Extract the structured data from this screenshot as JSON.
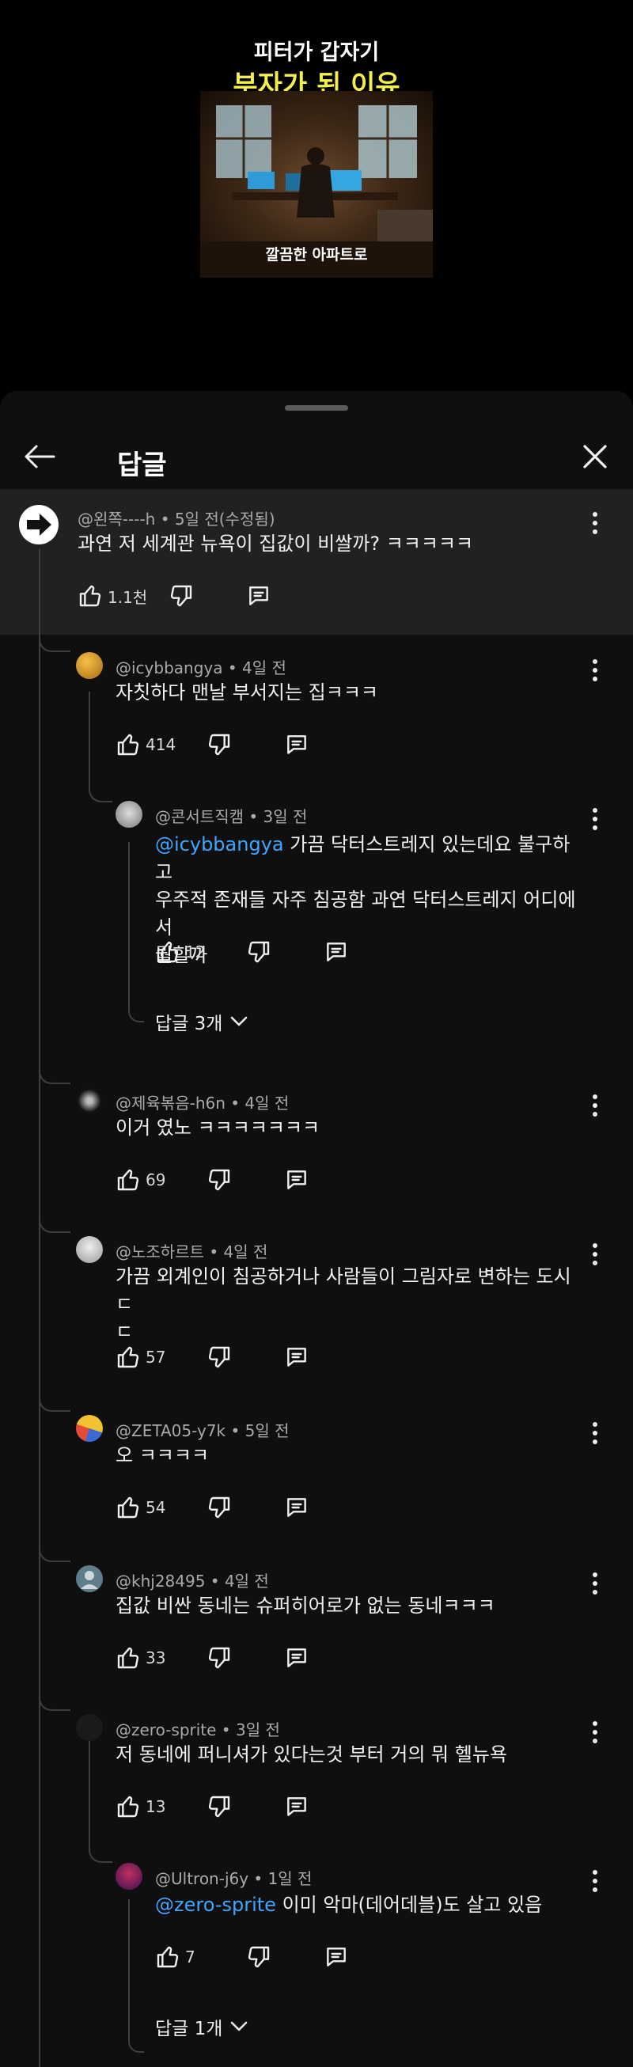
{
  "video": {
    "title_line1": "피터가 갑자기",
    "title_line2": "부자가 된 이유",
    "caption": "깔끔한 아파트로"
  },
  "header": {
    "title": "답글"
  },
  "top_comment": {
    "meta": "@왼쪽----h • 5일 전(수정됨)",
    "text": "과연 저 세계관 뉴욕이 집값이 비쌀까? ㅋㅋㅋㅋㅋ",
    "likes": "1.1천"
  },
  "replies": [
    {
      "meta": "@icybbangya • 4일 전",
      "text": "자칫하다 맨날 부서지는 집ㅋㅋㅋ",
      "likes": "414"
    },
    {
      "meta": "@콘서트직캠 • 3일 전",
      "mention": "@icybbangya",
      "text_line1": " 가끔 닥터스트레지 있는데요 불구하고",
      "text_line2": "우주적 존재들 자주 침공함 과연 닥터스트레지 어디에서",
      "text_line3": "뭘할까",
      "likes": "12",
      "sub_replies": "답글 3개"
    },
    {
      "meta": "@제육볶음-h6n • 4일 전",
      "text": "이거 였노 ㅋㅋㅋㅋㅋㅋㅋ",
      "likes": "69"
    },
    {
      "meta": "@노조하르트 • 4일 전",
      "text_line1": "가끔 외계인이 침공하거나 사람들이 그림자로 변하는 도시 ㄷ",
      "text_line2": "ㄷ",
      "likes": "57"
    },
    {
      "meta": "@ZETA05-y7k • 5일 전",
      "text": "오 ㅋㅋㅋㅋ",
      "likes": "54"
    },
    {
      "meta": "@khj28495 • 4일 전",
      "text": "집값 비싼 동네는 슈퍼히어로가 없는 동네ㅋㅋㅋ",
      "likes": "33"
    },
    {
      "meta": "@zero-sprite • 3일 전",
      "text": "저 동네에 퍼니셔가 있다는것 부터 거의 뭐 헬뉴욕",
      "likes": "13"
    },
    {
      "meta": "@Ultron-j6y • 1일 전",
      "mention": "@zero-sprite",
      "text": "  이미 악마(데어데블)도 살고 있음",
      "likes": "7",
      "sub_replies": "답글 1개"
    }
  ],
  "colors": {
    "sheet_bg": "#0f0f0f",
    "highlight_bg": "#212121",
    "mention": "#3ea6ff",
    "title_yellow": "#f4f04a"
  },
  "icons": [
    "back-arrow-icon",
    "close-icon",
    "more-vert-icon",
    "thumb-up-icon",
    "thumb-down-icon",
    "reply-icon",
    "chevron-down-icon"
  ]
}
